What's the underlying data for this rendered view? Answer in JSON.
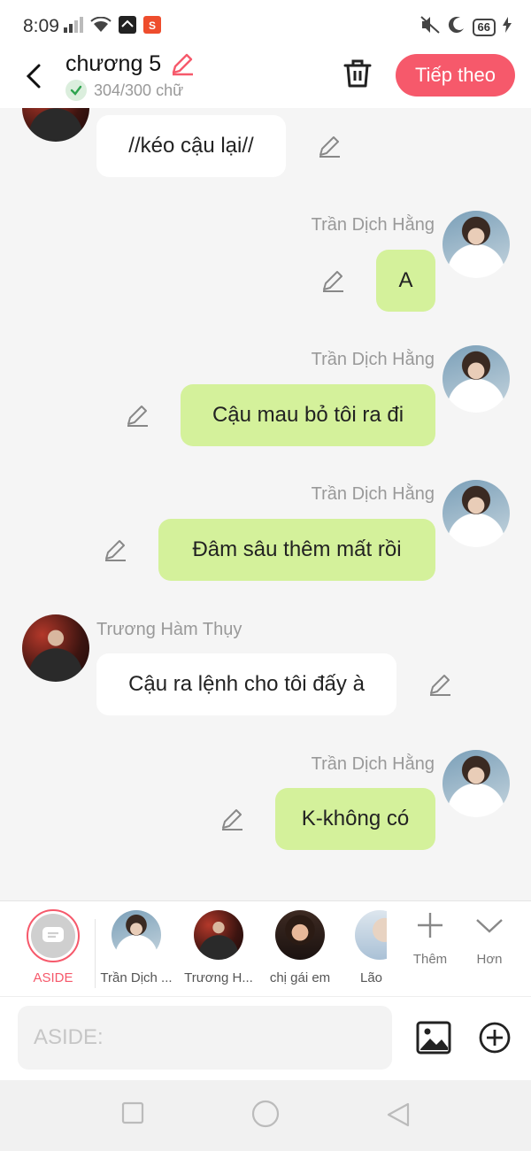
{
  "status_bar": {
    "time": "8:09",
    "battery": "66",
    "icons_left": [
      "signal-icon",
      "wifi-icon",
      "app-notification-icon",
      "shopee-icon"
    ],
    "icons_right": [
      "mute-icon",
      "moon-icon",
      "battery-icon",
      "charging-icon"
    ]
  },
  "header": {
    "title": "chương 5",
    "word_count": "304/300 chữ",
    "next_button": "Tiếp theo"
  },
  "messages": [
    {
      "side": "left",
      "sender": "",
      "text": "//kéo cậu lại//"
    },
    {
      "side": "right",
      "sender": "Trần Dịch Hằng",
      "text": "A"
    },
    {
      "side": "right",
      "sender": "Trần Dịch Hằng",
      "text": "Cậu mau bỏ tôi ra đi"
    },
    {
      "side": "right",
      "sender": "Trần Dịch Hằng",
      "text": "Đâm sâu thêm mất rồi"
    },
    {
      "side": "left",
      "sender": "Trương Hàm Thụy",
      "text": "Cậu ra lệnh cho tôi đấy à"
    },
    {
      "side": "right",
      "sender": "Trần Dịch Hằng",
      "text": "K-không có"
    }
  ],
  "characters": {
    "aside_label": "ASIDE",
    "items": [
      {
        "label": "Trần Dịch ..."
      },
      {
        "label": "Trương H..."
      },
      {
        "label": "chị gái em"
      },
      {
        "label": "Lão"
      }
    ],
    "add_label": "Thêm",
    "more_label": "Hơn"
  },
  "composer": {
    "placeholder": "ASIDE:"
  },
  "colors": {
    "accent": "#f6596b",
    "right_bubble": "#d4f19b",
    "left_bubble": "#ffffff",
    "background": "#f5f5f5"
  }
}
